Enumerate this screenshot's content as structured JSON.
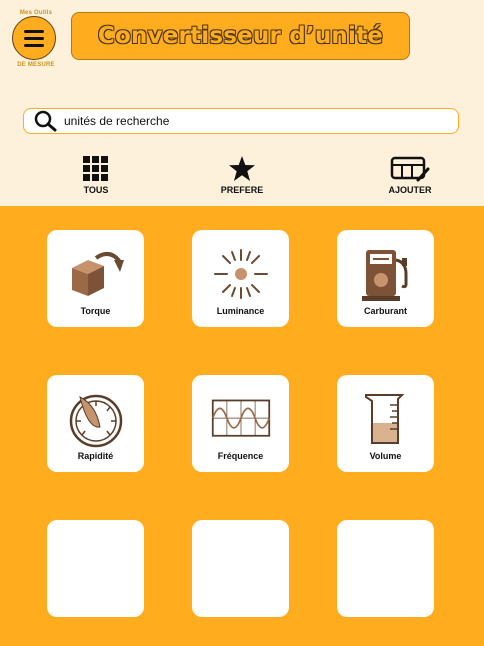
{
  "header": {
    "brand_top": "Mes Outils",
    "brand_bottom": "DE MESURE",
    "title": "Convertisseur d’unité"
  },
  "search": {
    "placeholder": "unités de recherche",
    "icon": "search-icon"
  },
  "nav": [
    {
      "label": "TOUS",
      "icon": "grid-icon"
    },
    {
      "label": "PREFERE",
      "icon": "star-icon"
    },
    {
      "label": "AJOUTER",
      "icon": "edit-table-icon"
    }
  ],
  "tiles": [
    {
      "label": "Torque",
      "icon": "torque-icon"
    },
    {
      "label": "Luminance",
      "icon": "sun-icon"
    },
    {
      "label": "Carburant",
      "icon": "fuel-pump-icon"
    },
    {
      "label": "Rapidité",
      "icon": "speedometer-icon"
    },
    {
      "label": "Fréquence",
      "icon": "wave-icon"
    },
    {
      "label": "Volume",
      "icon": "beaker-icon"
    },
    {
      "label": "",
      "icon": ""
    },
    {
      "label": "",
      "icon": ""
    },
    {
      "label": "",
      "icon": ""
    }
  ],
  "colors": {
    "accent": "#ffad1f",
    "header_bg": "#fdf1db",
    "icon_brown": "#8a5a3a"
  }
}
